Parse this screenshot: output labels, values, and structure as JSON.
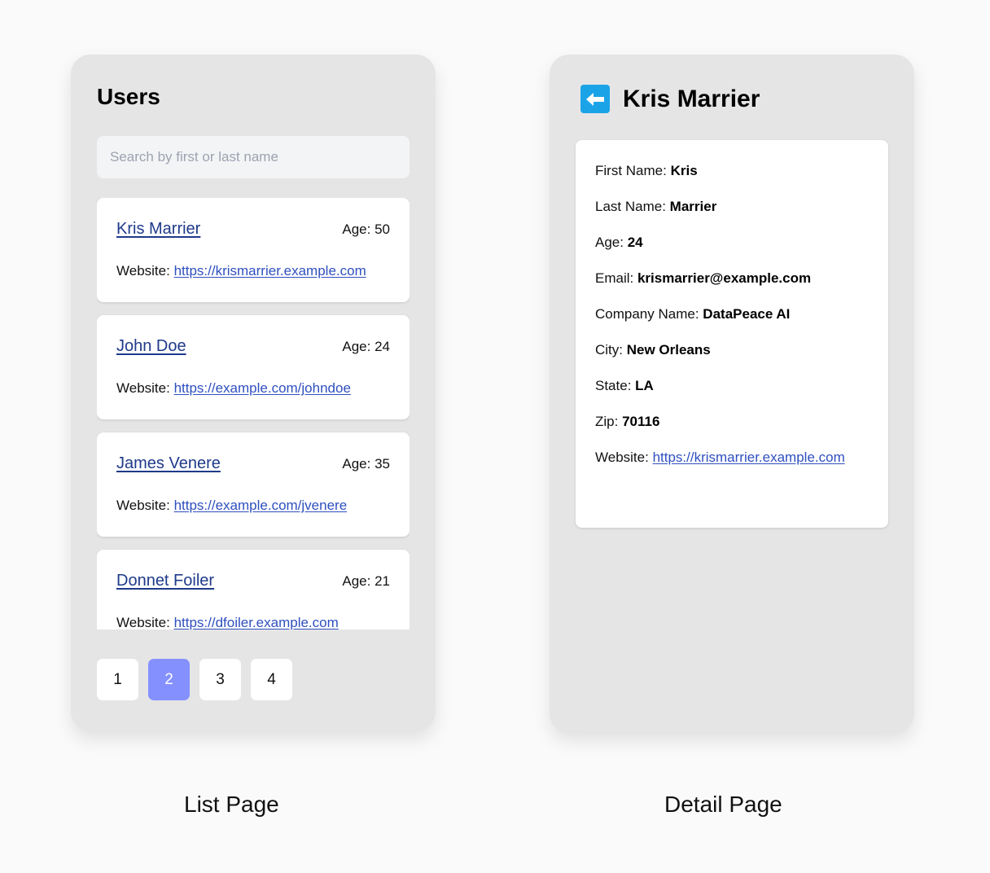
{
  "list_page": {
    "title": "Users",
    "search": {
      "placeholder": "Search by first or last name",
      "value": ""
    },
    "website_label": "Website:",
    "users": [
      {
        "name": "Kris Marrier",
        "age": "Age: 50",
        "website": "https://krismarrier.example.com"
      },
      {
        "name": "John Doe",
        "age": "Age: 24",
        "website": "https://example.com/johndoe"
      },
      {
        "name": "James Venere",
        "age": "Age: 35",
        "website": "https://example.com/jvenere"
      },
      {
        "name": "Donnet Foiler",
        "age": "Age: 21",
        "website": "https://dfoiler.example.com"
      }
    ],
    "pagination": {
      "pages": [
        "1",
        "2",
        "3",
        "4"
      ],
      "active": "2"
    }
  },
  "detail_page": {
    "title": "Kris Marrier",
    "back_icon": "arrow-left-icon",
    "fields": [
      {
        "label": "First Name:",
        "value": "Kris"
      },
      {
        "label": "Last Name:",
        "value": "Marrier"
      },
      {
        "label": "Age:",
        "value": "24"
      },
      {
        "label": "Email:",
        "value": "krismarrier@example.com"
      },
      {
        "label": "Company Name:",
        "value": "DataPeace AI"
      },
      {
        "label": "City:",
        "value": "New Orleans"
      },
      {
        "label": "State:",
        "value": "LA"
      },
      {
        "label": "Zip:",
        "value": "70116"
      }
    ],
    "website": {
      "label": "Website:",
      "value": "https://krismarrier.example.com"
    }
  },
  "captions": {
    "list": "List Page",
    "detail": "Detail Page"
  },
  "colors": {
    "link": "#2f4fbf",
    "name_link": "#1e3a8a",
    "active_page": "#8590ff",
    "back_button": "#1ba3e8",
    "panel": "#e5e5e5"
  }
}
